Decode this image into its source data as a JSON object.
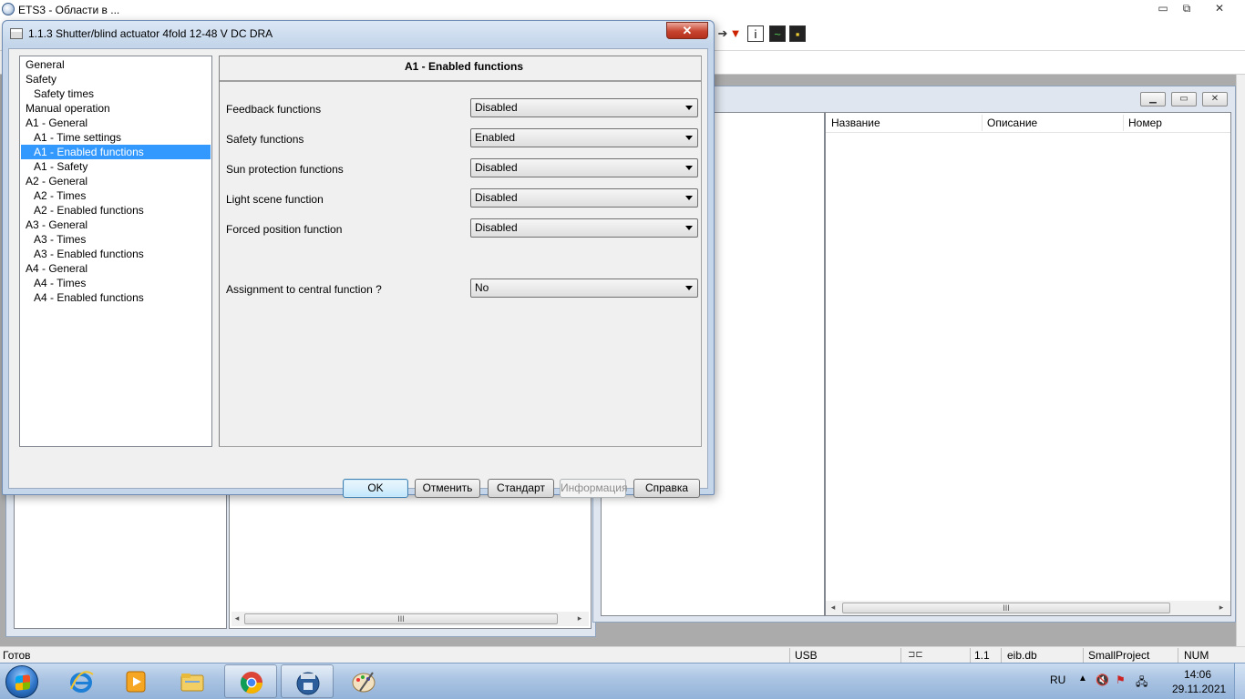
{
  "main_window": {
    "title": "ETS3 - Области в ...",
    "min_label": "▭",
    "max_label": "⧉",
    "close_label": "✕"
  },
  "dialog": {
    "title": "1.1.3 Shutter/blind actuator 4fold 12-48 V DC DRA",
    "close_label": "✕",
    "tree": [
      {
        "label": "General",
        "indent": 0,
        "selected": false
      },
      {
        "label": "Safety",
        "indent": 0,
        "selected": false
      },
      {
        "label": "Safety times",
        "indent": 1,
        "selected": false
      },
      {
        "label": "Manual operation",
        "indent": 0,
        "selected": false
      },
      {
        "label": "A1 - General",
        "indent": 0,
        "selected": false
      },
      {
        "label": "A1 - Time settings",
        "indent": 1,
        "selected": false
      },
      {
        "label": "A1 - Enabled functions",
        "indent": 1,
        "selected": true
      },
      {
        "label": "A1 - Safety",
        "indent": 1,
        "selected": false
      },
      {
        "label": "A2 - General",
        "indent": 0,
        "selected": false
      },
      {
        "label": "A2 - Times",
        "indent": 1,
        "selected": false
      },
      {
        "label": "A2 - Enabled functions",
        "indent": 1,
        "selected": false
      },
      {
        "label": "A3 - General",
        "indent": 0,
        "selected": false
      },
      {
        "label": "A3 - Times",
        "indent": 1,
        "selected": false
      },
      {
        "label": "A3 - Enabled functions",
        "indent": 1,
        "selected": false
      },
      {
        "label": "A4 - General",
        "indent": 0,
        "selected": false
      },
      {
        "label": "A4 - Times",
        "indent": 1,
        "selected": false
      },
      {
        "label": "A4 - Enabled functions",
        "indent": 1,
        "selected": false
      }
    ],
    "section_title": "A1 - Enabled functions",
    "params": [
      {
        "label": "Feedback functions",
        "value": "Disabled"
      },
      {
        "label": "Safety functions",
        "value": "Enabled"
      },
      {
        "label": "Sun protection functions",
        "value": "Disabled"
      },
      {
        "label": "Light scene function",
        "value": "Disabled"
      },
      {
        "label": "Forced position function",
        "value": "Disabled"
      },
      {
        "label": "Assignment to central function ?",
        "value": "No"
      }
    ],
    "buttons": {
      "ok": "OK",
      "cancel": "Отменить",
      "default": "Стандарт",
      "info": "Информация",
      "help": "Справка"
    }
  },
  "list_view": {
    "columns": [
      "Название",
      "Описание",
      "Номер"
    ],
    "scroll_grip": "III",
    "arrow_left": "◂",
    "arrow_right": "▸"
  },
  "status_bar": {
    "ready": "Готов",
    "interface": "USB",
    "address": "1.1",
    "database": "eib.db",
    "project": "SmallProject",
    "num": "NUM"
  },
  "taskbar": {
    "language": "RU",
    "time": "14:06",
    "date": "29.11.2021",
    "apps": [
      "ie-icon",
      "media-player-icon",
      "explorer-folder-icon",
      "chrome-icon",
      "ets3-icon",
      "paint-icon"
    ]
  },
  "colors": {
    "selection": "#3399ff",
    "dialog_frame": "#c5d6ea",
    "close_red": "#c7442f"
  }
}
